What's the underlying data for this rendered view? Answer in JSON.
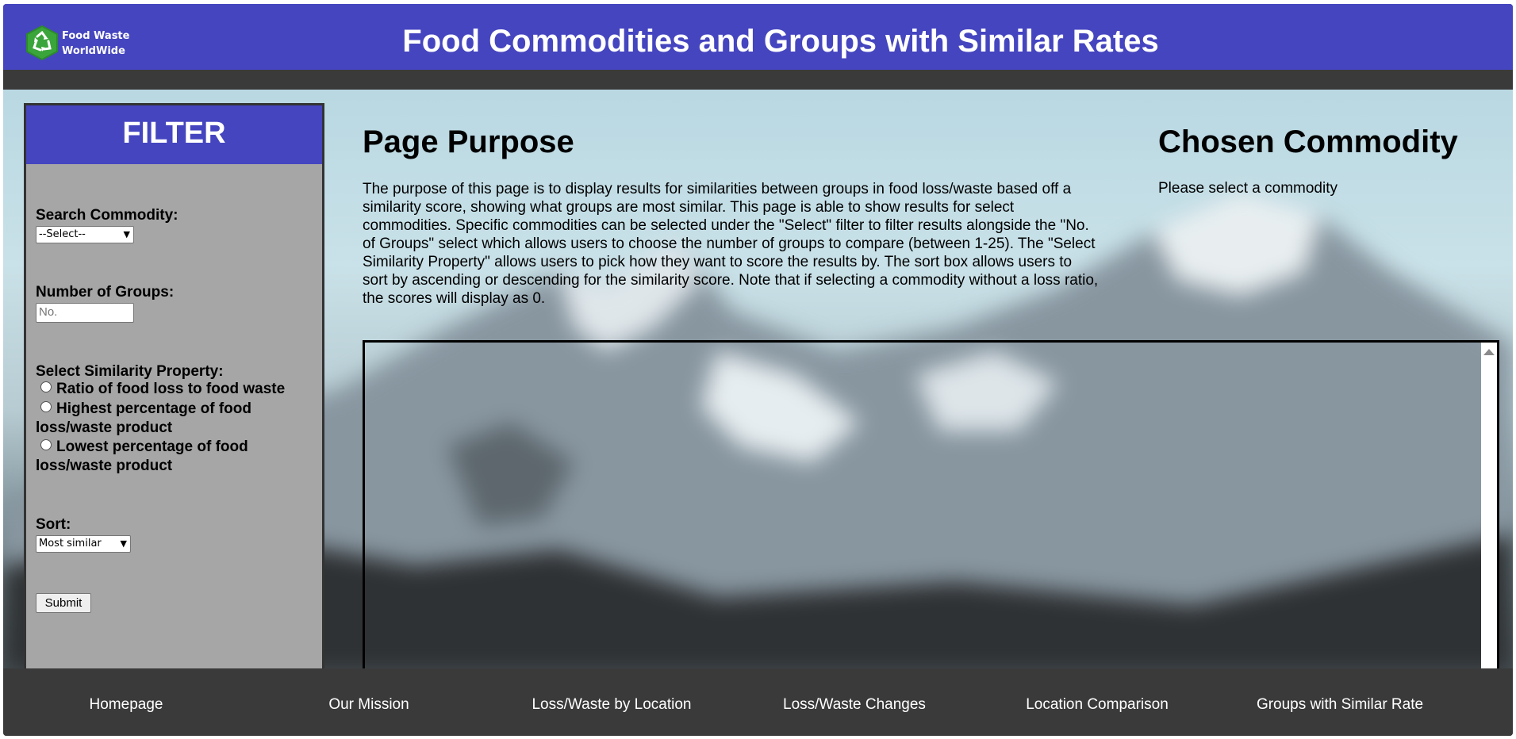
{
  "header": {
    "logo_line1": "Food Waste",
    "logo_line2": "WorldWide",
    "title": "Food Commodities and Groups with Similar Rates",
    "logo_icon": "recycle-icon"
  },
  "filter": {
    "heading": "FILTER",
    "commodity_label": "Search Commodity:",
    "commodity_selected": "--Select--",
    "groups_label": "Number of Groups:",
    "groups_placeholder": "No.",
    "property_label": "Select Similarity Property:",
    "property_options": [
      "Ratio of food loss to food waste",
      "Highest percentage of food loss/waste product",
      "Lowest percentage of food loss/waste product"
    ],
    "sort_label": "Sort:",
    "sort_selected": "Most similar",
    "submit_label": "Submit"
  },
  "main": {
    "purpose_heading": "Page Purpose",
    "purpose_text": "The purpose of this page is to display results for similarities between groups in food loss/waste based off a similarity score, showing what groups are most similar. This page is able to show results for select commodities. Specific commodities can be selected under the \"Select\" filter to filter results alongside the \"No. of Groups\" select which allows users to choose the number of groups to compare (between 1-25). The \"Select Similarity Property\" allows users to pick how they want to score the results by. The sort box allows users to sort by ascending or descending for the similarity score. Note that if selecting a commodity without a loss ratio, the scores will display as 0.",
    "chosen_heading": "Chosen Commodity",
    "chosen_text": "Please select a commodity"
  },
  "footer": {
    "links": [
      "Homepage",
      "Our Mission",
      "Loss/Waste by Location",
      "Loss/Waste Changes",
      "Location Comparison",
      "Groups with Similar Rate"
    ]
  },
  "colors": {
    "header": "#4545c0",
    "panel": "#a6a6a6",
    "dark": "#3a3a3a"
  }
}
